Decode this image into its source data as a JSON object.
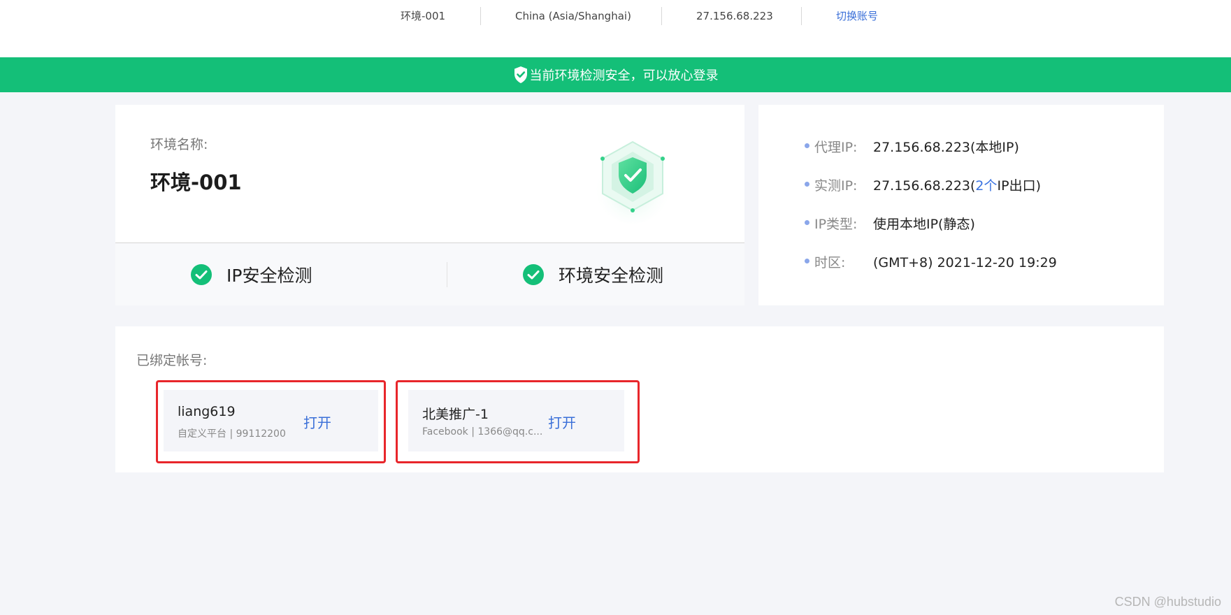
{
  "topbar": {
    "env": "环境-001",
    "timezone": "China (Asia/Shanghai)",
    "ip": "27.156.68.223",
    "switch_account": "切换账号"
  },
  "banner": {
    "text": "当前环境检测安全，可以放心登录",
    "icon": "shield-check-icon",
    "color": "#14bf78"
  },
  "environment": {
    "label": "环境名称:",
    "name": "环境-001",
    "checks": [
      {
        "label": "IP安全检测",
        "icon": "check-circle-icon"
      },
      {
        "label": "环境安全检测",
        "icon": "check-circle-icon"
      }
    ]
  },
  "ip_info": {
    "proxy_ip": {
      "key": "代理IP:",
      "value": "27.156.68.223(本地IP)"
    },
    "real_ip": {
      "key": "实测IP:",
      "value_prefix": "27.156.68.223(",
      "value_highlight": "2个",
      "value_suffix": "IP出口)"
    },
    "ip_type": {
      "key": "IP类型:",
      "value": "使用本地IP(静态)"
    },
    "timezone": {
      "key": "时区:",
      "value": "(GMT+8) 2021-12-20 19:29"
    }
  },
  "accounts": {
    "title": "已绑定帐号:",
    "items": [
      {
        "name": "liang619",
        "sub": "自定义平台 | 99112200",
        "open": "打开"
      },
      {
        "name": "北美推广-1",
        "sub": "Facebook | 1366@qq.c...",
        "open": "打开"
      }
    ]
  },
  "watermark": "CSDN @hubstudio",
  "colors": {
    "accent": "#14bf78",
    "link": "#3a6fd8",
    "highlight_box": "#e8262b"
  }
}
